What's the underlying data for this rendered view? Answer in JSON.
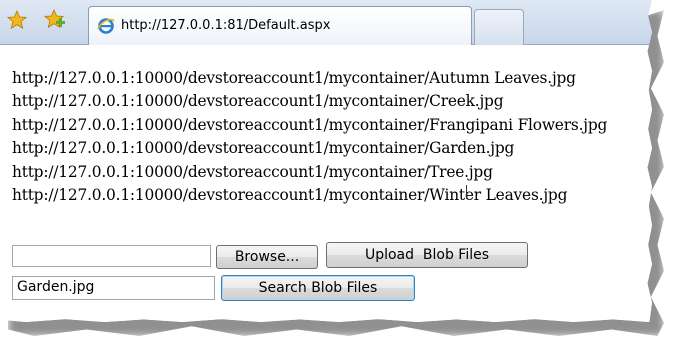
{
  "browser": {
    "url": "http://127.0.0.1:81/Default.aspx",
    "icons": [
      "favorites-star-icon",
      "add-favorite-icon",
      "ie-page-icon"
    ]
  },
  "blobs": [
    "http://127.0.0.1:10000/devstoreaccount1/mycontainer/Autumn Leaves.jpg",
    "http://127.0.0.1:10000/devstoreaccount1/mycontainer/Creek.jpg",
    "http://127.0.0.1:10000/devstoreaccount1/mycontainer/Frangipani Flowers.jpg",
    "http://127.0.0.1:10000/devstoreaccount1/mycontainer/Garden.jpg",
    "http://127.0.0.1:10000/devstoreaccount1/mycontainer/Tree.jpg",
    "http://127.0.0.1:10000/devstoreaccount1/mycontainer/Winter Leaves.jpg"
  ],
  "upload": {
    "file_value": "",
    "browse_label": "Browse...",
    "upload_label": "Upload  Blob Files"
  },
  "search": {
    "value": "Garden.jpg",
    "search_label": "Search Blob Files"
  },
  "colors": {
    "toolbar": "#d5e0ef",
    "star": "#f2b71a",
    "add_star": "#5fae2e"
  }
}
